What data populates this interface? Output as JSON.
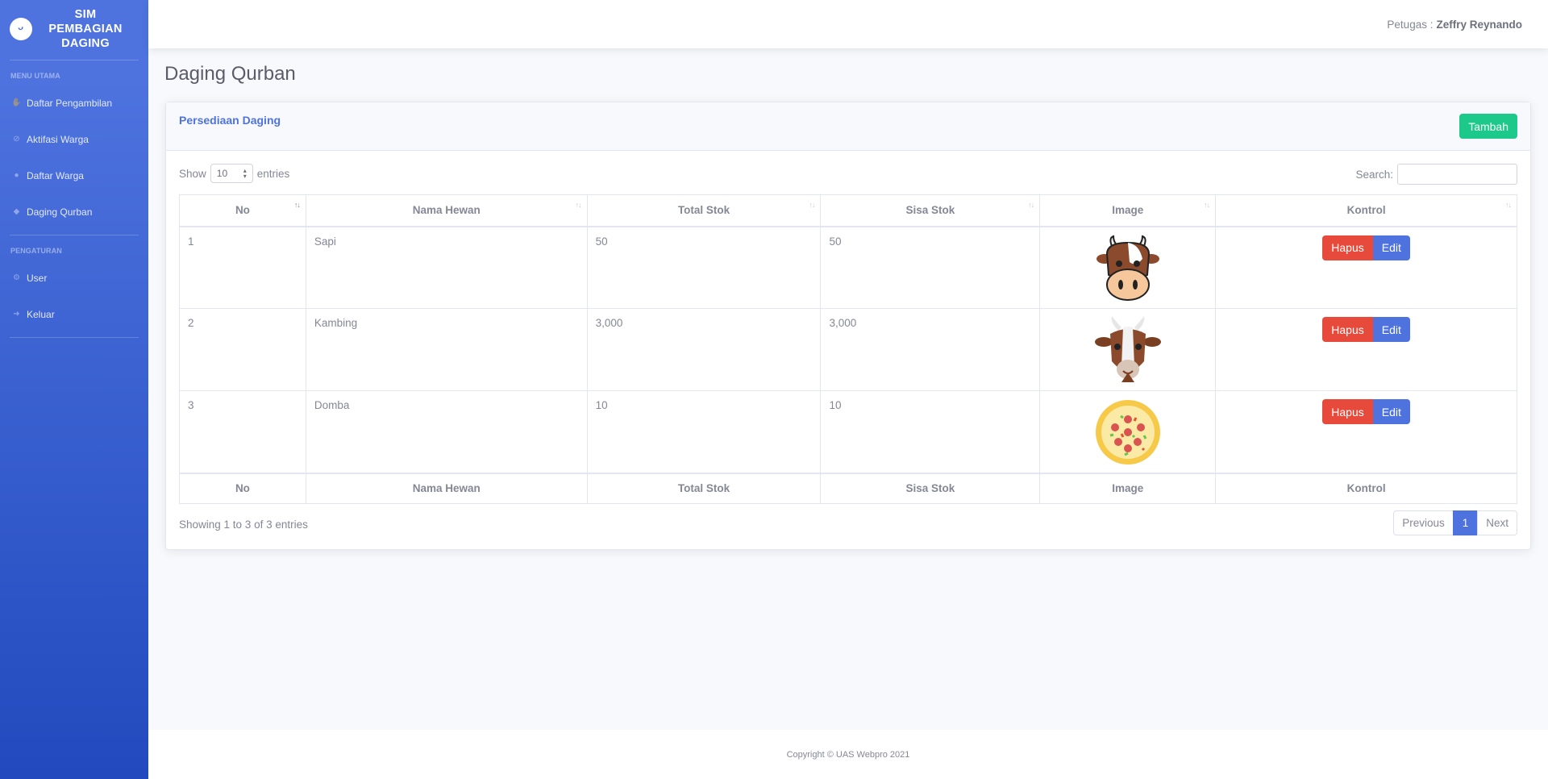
{
  "sidebar": {
    "brand_icon": "laugh-wink-icon",
    "brand_line1": "SIM",
    "brand_line2": "PEMBAGIAN",
    "brand_line3": "DAGING",
    "heading_main": "MENU UTAMA",
    "heading_settings": "PENGATURAN",
    "items": [
      {
        "label": "Daftar Pengambilan",
        "icon": "hands-icon"
      },
      {
        "label": "Aktifasi Warga",
        "icon": "tag-icon"
      },
      {
        "label": "Daftar Warga",
        "icon": "user-icon"
      },
      {
        "label": "Daging Qurban",
        "icon": "cow-icon"
      },
      {
        "label": "User",
        "icon": "users-cog-icon"
      },
      {
        "label": "Keluar",
        "icon": "sign-out-icon"
      }
    ]
  },
  "topbar": {
    "label": "Petugas :",
    "user_name": "Zeffry Reynando"
  },
  "page": {
    "title": "Daging Qurban"
  },
  "card": {
    "title": "Persediaan Daging",
    "add_button": "Tambah",
    "show_label": "Show",
    "entries_value": "10",
    "entries_label": "entries",
    "search_label": "Search:",
    "columns": [
      "No",
      "Nama Hewan",
      "Total Stok",
      "Sisa Stok",
      "Image",
      "Kontrol"
    ],
    "rows": [
      {
        "no": "1",
        "nama": "Sapi",
        "total": "50",
        "sisa": "50",
        "image": "cow-face-icon"
      },
      {
        "no": "2",
        "nama": "Kambing",
        "total": "3,000",
        "sisa": "3,000",
        "image": "goat-face-icon"
      },
      {
        "no": "3",
        "nama": "Domba",
        "total": "10",
        "sisa": "10",
        "image": "pizza-icon"
      }
    ],
    "delete_label": "Hapus",
    "edit_label": "Edit",
    "info": "Showing 1 to 3 of 3 entries",
    "pager": {
      "previous": "Previous",
      "page": "1",
      "next": "Next"
    }
  },
  "footer": {
    "copyright": "Copyright © UAS Webpro 2021"
  },
  "colors": {
    "primary": "#4e73df",
    "success": "#1cc88a",
    "danger": "#e74a3b"
  }
}
